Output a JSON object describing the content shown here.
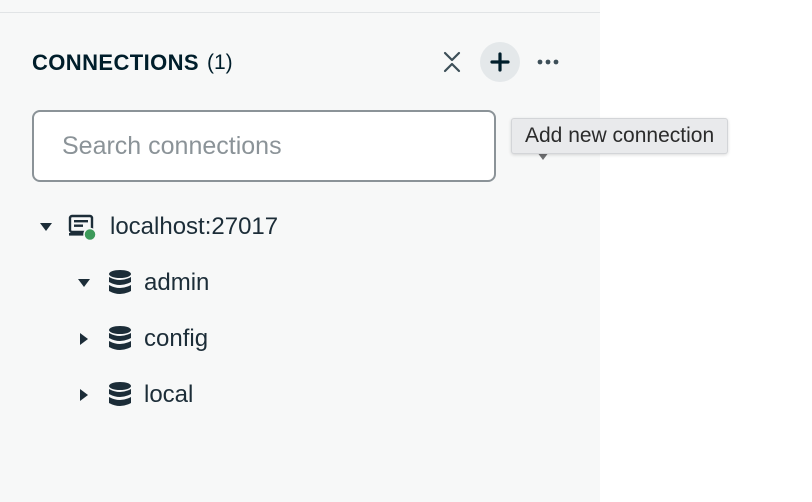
{
  "sidebar": {
    "header": {
      "title": "CONNECTIONS",
      "count": "(1)"
    },
    "actions": {
      "collapse_icon": "collapse-all-icon",
      "add_icon": "plus-icon",
      "more_icon": "ellipsis-icon"
    },
    "search": {
      "placeholder": "Search connections",
      "value": ""
    },
    "tooltip": {
      "text": "Add new connection"
    },
    "connection": {
      "label": "localhost:27017",
      "status_color": "#3d9a5a",
      "expanded": true,
      "databases": [
        {
          "label": "admin",
          "expanded": true
        },
        {
          "label": "config",
          "expanded": false
        },
        {
          "label": "local",
          "expanded": false
        }
      ]
    }
  }
}
